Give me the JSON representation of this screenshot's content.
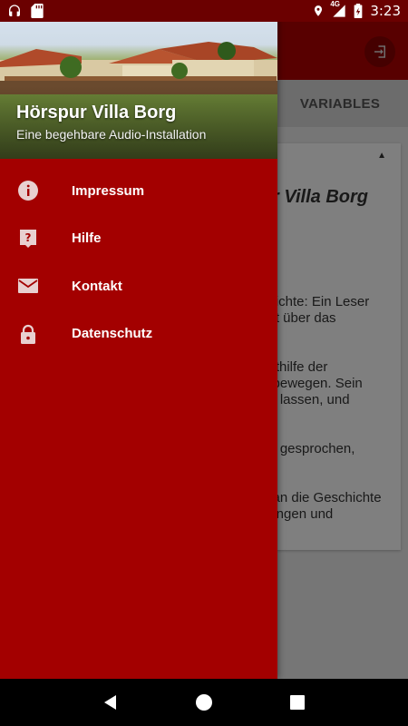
{
  "status_bar": {
    "time": "3:23",
    "network_label": "4G",
    "icons": [
      "headset-icon",
      "sd-card-icon",
      "location-icon",
      "signal-icon",
      "battery-icon"
    ]
  },
  "app": {
    "tabs": [
      {
        "label": "VARIABLES"
      }
    ],
    "card": {
      "title_partial": "r Villa Borg",
      "text_partial": [
        "chichte: Ein Leser",
        "ext über das",
        "mithilfe der",
        "e bewegen. Sein",
        "he lassen, und",
        "ler gesprochen,",
        "man die Geschichte",
        "dungen und"
      ]
    }
  },
  "drawer": {
    "title": "Hörspur Villa Borg",
    "subtitle": "Eine begehbare Audio-Installation",
    "items": [
      {
        "label": "Impressum",
        "icon": "info-icon"
      },
      {
        "label": "Hilfe",
        "icon": "help-icon"
      },
      {
        "label": "Kontakt",
        "icon": "mail-icon"
      },
      {
        "label": "Datenschutz",
        "icon": "lock-icon"
      }
    ]
  },
  "colors": {
    "drawer_bg": "#a30000",
    "toolbar_bg": "#b00000",
    "status_bar_bg": "#6b0000"
  }
}
